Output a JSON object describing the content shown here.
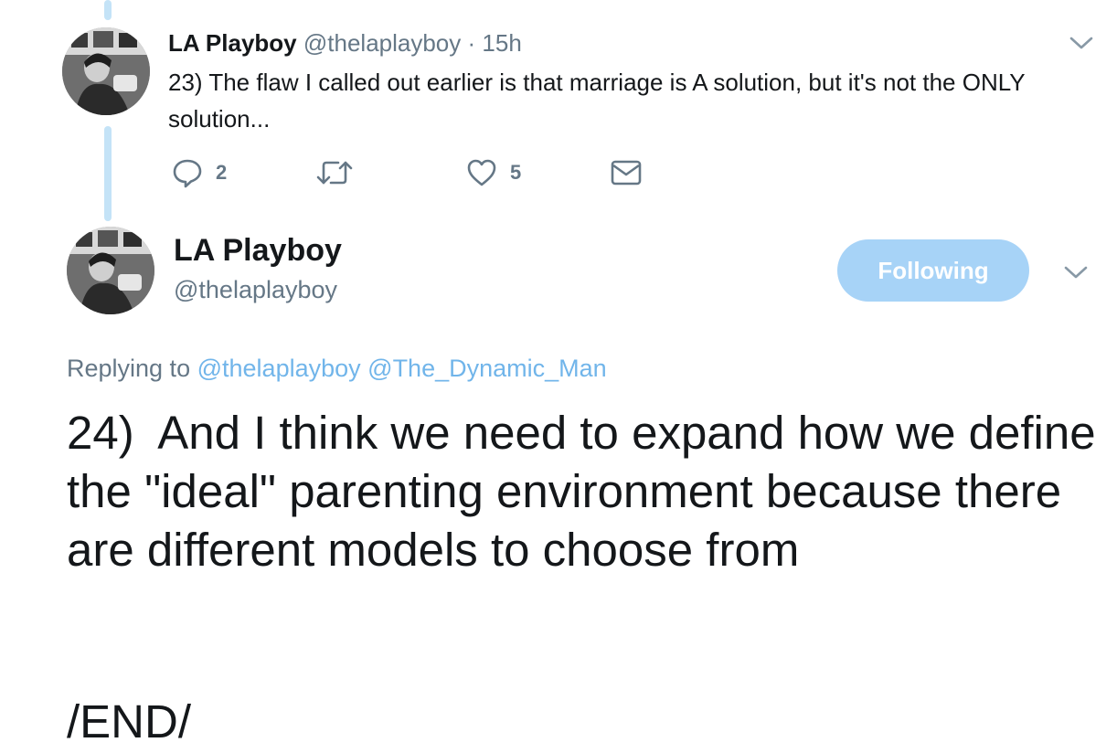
{
  "thread_tweet": {
    "author_name": "LA Playboy",
    "author_handle": "@thelaplayboy",
    "separator": "·",
    "time": "15h",
    "text": "23) The flaw I called out earlier is that marriage is A solution, but it's not the ONLY solution...",
    "actions": {
      "reply_count": "2",
      "retweet_count": "",
      "like_count": "5"
    },
    "icons": {
      "reply": "reply-icon",
      "retweet": "retweet-icon",
      "like": "heart-icon",
      "dm": "envelope-icon",
      "menu": "chevron-down-icon"
    }
  },
  "main_tweet": {
    "author_name": "LA Playboy",
    "author_handle": "@thelaplayboy",
    "follow_label": "Following",
    "replying_prefix": "Replying to",
    "replying_mentions": [
      "@thelaplayboy",
      "@The_Dynamic_Man"
    ],
    "text": "24)  And I think we need to expand how we define the \"ideal\" parenting environment because there are different models to choose from",
    "text_end": "/END/"
  },
  "colors": {
    "text_primary": "#14171a",
    "text_secondary": "#657786",
    "mention": "#71b5ea",
    "follow_button_bg": "#a7d3f7",
    "thread_line": "#c4e3f7"
  }
}
